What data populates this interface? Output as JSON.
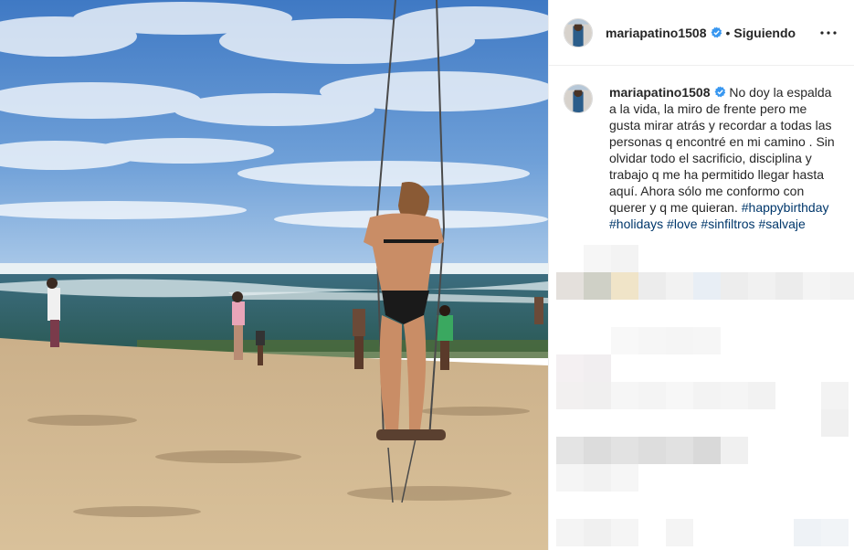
{
  "post": {
    "username": "mariapatino1508",
    "follow_status": "Siguiendo",
    "separator": "•",
    "caption_text": "No doy la espalda a la vida, la miro de frente pero me gusta mirar atrás y recordar a todas las personas q encontré en mi camino . Sin olvidar todo el sacrificio, disciplina y trabajo q me ha permitido llegar hasta aquí. Ahora sólo me conformo con querer y q me quieran.",
    "hashtags": [
      "#happybirthday",
      "#holidays",
      "#love",
      "#sinfiltros",
      "#salvaje"
    ]
  },
  "icons": {
    "verified": "verified-badge-icon",
    "more": "more-options-icon"
  },
  "colors": {
    "verified": "#3897f0",
    "hashtag": "#00376b",
    "text": "#262626",
    "border": "#efefef"
  }
}
